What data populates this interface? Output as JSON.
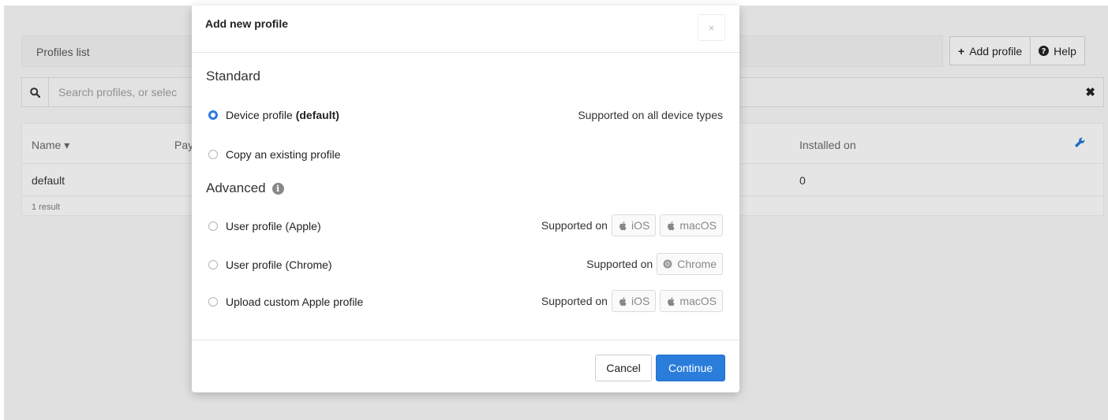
{
  "background": {
    "header_title": "Profiles list",
    "add_profile_label": "Add profile",
    "help_label": "Help",
    "search_placeholder": "Search profiles, or selec",
    "columns": {
      "name": "Name ▾",
      "payload": "Pay",
      "installed_on": "Installed on"
    },
    "rows": [
      {
        "name": "default",
        "installed_on": "0"
      }
    ],
    "result_count": "1 result"
  },
  "modal": {
    "title": "Add new profile",
    "close_label": "×",
    "standard_heading": "Standard",
    "advanced_heading": "Advanced",
    "standard_options": [
      {
        "label": "Device profile",
        "suffix": "(default)",
        "support_text": "Supported on all device types",
        "selected": true
      },
      {
        "label": "Copy an existing profile",
        "suffix": "",
        "support_text": "",
        "selected": false
      }
    ],
    "advanced_options": [
      {
        "label": "User profile (Apple)",
        "supported_on": "Supported on",
        "platforms": [
          "iOS",
          "macOS"
        ]
      },
      {
        "label": "User profile (Chrome)",
        "supported_on": "Supported on",
        "platforms": [
          "Chrome"
        ]
      },
      {
        "label": "Upload custom Apple profile",
        "supported_on": "Supported on",
        "platforms": [
          "iOS",
          "macOS"
        ]
      }
    ],
    "cancel_label": "Cancel",
    "continue_label": "Continue"
  },
  "colors": {
    "primary": "#2b7ddb",
    "radio_selected": "#2d7be0"
  }
}
